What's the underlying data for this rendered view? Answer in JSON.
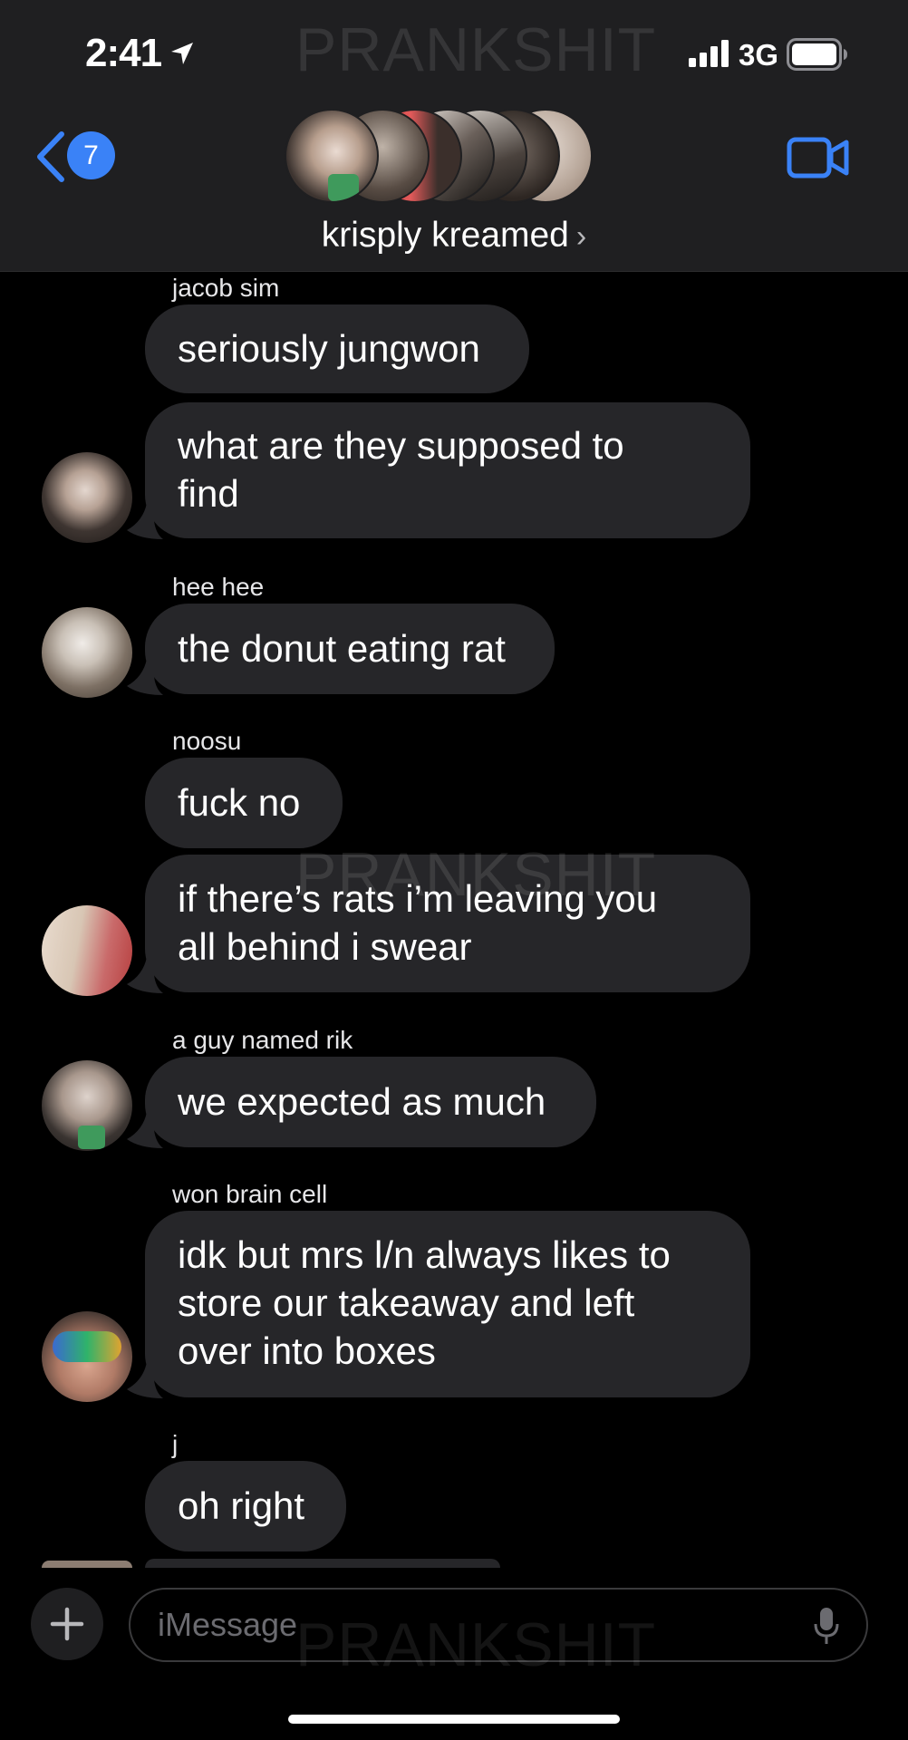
{
  "status_bar": {
    "time": "2:41",
    "network": "3G"
  },
  "header": {
    "unread_count": "7",
    "group_name": "krisply kreamed",
    "chevron": "›"
  },
  "watermark": "PRANKSHIT",
  "messages": [
    {
      "sender": "jacob sim",
      "bubbles": [
        "seriously jungwon",
        "what are they supposed to\nfind"
      ]
    },
    {
      "sender": "hee hee",
      "bubbles": [
        "the donut eating rat"
      ]
    },
    {
      "sender": "noosu",
      "bubbles": [
        "fuck no",
        "if there’s rats i’m leaving you\nall behind i swear"
      ]
    },
    {
      "sender": "a guy named rik",
      "bubbles": [
        "we expected as much"
      ]
    },
    {
      "sender": "won brain cell",
      "bubbles": [
        "idk but mrs l/n always likes to\nstore our takeaway and left\nover into boxes"
      ]
    },
    {
      "sender": "j",
      "bubbles": [
        "oh right"
      ]
    }
  ],
  "input": {
    "placeholder": "iMessage"
  },
  "colors": {
    "accent": "#3a82f7",
    "bubble": "#262629",
    "header": "#1f1f21",
    "background": "#000000"
  },
  "icons": [
    "location-arrow-icon",
    "signal-icon",
    "battery-icon",
    "back-chevron-icon",
    "video-camera-icon",
    "plus-icon",
    "microphone-icon"
  ]
}
